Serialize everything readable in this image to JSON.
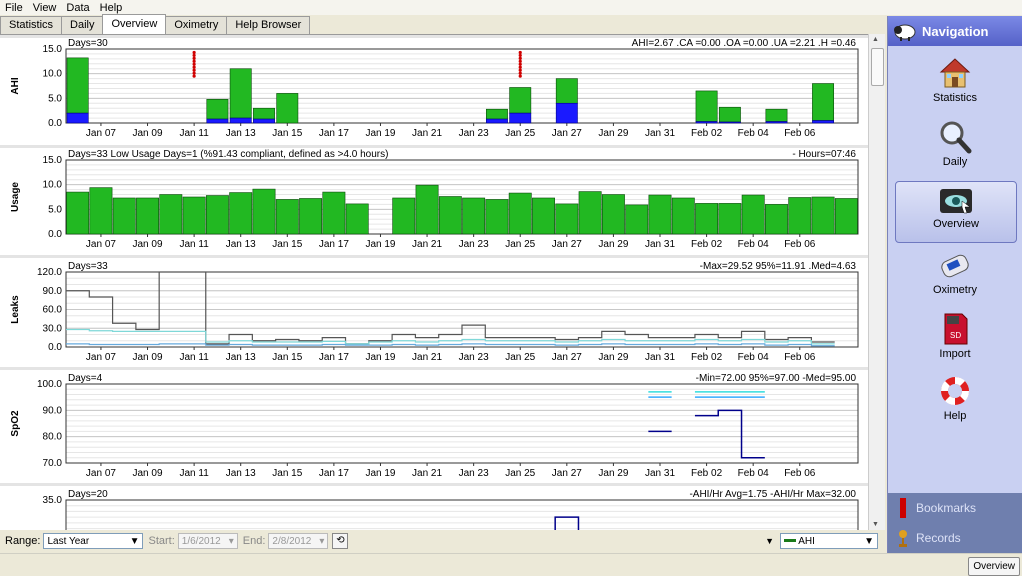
{
  "menu": [
    "File",
    "View",
    "Data",
    "Help"
  ],
  "tabs": [
    {
      "label": "Statistics",
      "active": false
    },
    {
      "label": "Daily",
      "active": false
    },
    {
      "label": "Overview",
      "active": true
    },
    {
      "label": "Oximetry",
      "active": false
    },
    {
      "label": "Help Browser",
      "active": false
    }
  ],
  "x_tick_labels": [
    "Jan 07",
    "Jan 09",
    "Jan 11",
    "Jan 13",
    "Jan 15",
    "Jan 17",
    "Jan 19",
    "Jan 21",
    "Jan 23",
    "Jan 25",
    "Jan 27",
    "Jan 29",
    "Jan 31",
    "Feb 02",
    "Feb 04",
    "Feb 06"
  ],
  "charts": {
    "ahi": {
      "ylabel": "AHI",
      "header_left": "Days=30",
      "header_right": "AHI=2.67  .CA =0.00  .OA =0.00  .UA =2.21  .H =0.46",
      "ticks": [
        "15.0",
        "10.0",
        "5.0",
        "0.0"
      ]
    },
    "usage": {
      "ylabel": "Usage",
      "header_left": "Days=33 Low Usage Days=1 (%91.43 compliant, defined as >4.0 hours)",
      "header_right": "- Hours=07:46",
      "ticks": [
        "15.0",
        "10.0",
        "5.0",
        "0.0"
      ]
    },
    "leaks": {
      "ylabel": "Leaks",
      "header_left": "Days=33",
      "header_right": "-Max=29.52  95%=11.91  .Med=4.63",
      "ticks": [
        "120.0",
        "90.0",
        "60.0",
        "30.0",
        "0.0"
      ]
    },
    "spo2": {
      "ylabel": "SpO2",
      "header_left": "Days=4",
      "header_right": "-Min=72.00  95%=97.00  -Med=95.00",
      "ticks": [
        "100.0",
        "90.0",
        "80.0",
        "70.0"
      ]
    },
    "ahihr": {
      "ylabel": "",
      "header_left": "Days=20",
      "header_right": "-AHI/Hr Avg=1.75  -AHI/Hr Max=32.00",
      "ticks": [
        "35.0",
        "28.0"
      ]
    }
  },
  "chart_data": [
    {
      "type": "bar",
      "title": "AHI",
      "ylim": [
        0,
        15
      ],
      "x_start": "Jan 06",
      "categories": [
        "Jan 06",
        "Jan 07",
        "Jan 08",
        "Jan 09",
        "Jan 10",
        "Jan 11",
        "Jan 12",
        "Jan 13",
        "Jan 14",
        "Jan 15",
        "Jan 16",
        "Jan 17",
        "Jan 18",
        "Jan 19",
        "Jan 20",
        "Jan 21",
        "Jan 22",
        "Jan 23",
        "Jan 24",
        "Jan 25",
        "Jan 26",
        "Jan 27",
        "Jan 28",
        "Jan 29",
        "Jan 30",
        "Jan 31",
        "Feb 01",
        "Feb 02",
        "Feb 03",
        "Feb 04",
        "Feb 05",
        "Feb 06",
        "Feb 07"
      ],
      "series": [
        {
          "name": "UA",
          "values": [
            2.0,
            0,
            0,
            0,
            0,
            0,
            0.8,
            1.0,
            0.8,
            0,
            0,
            0,
            0,
            0,
            0,
            0,
            0,
            0,
            0.8,
            2.0,
            0,
            4.0,
            0,
            0,
            0,
            0,
            0,
            0.3,
            0.2,
            0,
            0.3,
            0,
            0.5
          ]
        },
        {
          "name": "H",
          "values": [
            11.2,
            0,
            0,
            0,
            0,
            0,
            4.0,
            10.0,
            2.2,
            6.0,
            0,
            0,
            0,
            0,
            0,
            0,
            0,
            0,
            2.0,
            5.2,
            0,
            5.0,
            0,
            0,
            0,
            0,
            0,
            6.2,
            3.0,
            0,
            2.5,
            0,
            7.5
          ]
        }
      ]
    },
    {
      "type": "bar",
      "title": "Usage",
      "ylim": [
        0,
        15
      ],
      "x_start": "Jan 06",
      "values": [
        8.5,
        9.4,
        7.3,
        7.3,
        8.0,
        7.5,
        7.8,
        8.4,
        9.1,
        7.0,
        7.2,
        8.5,
        6.1,
        0,
        7.3,
        9.9,
        7.6,
        7.3,
        7.0,
        8.3,
        7.3,
        6.1,
        8.6,
        8.0,
        5.9,
        7.9,
        7.3,
        6.2,
        6.2,
        7.9,
        6.0,
        7.4,
        7.5,
        7.2
      ]
    },
    {
      "type": "line",
      "title": "Leaks",
      "ylim": [
        0,
        120
      ],
      "x_start": "Jan 06",
      "series": [
        {
          "name": "Max",
          "values": [
            90,
            80,
            38,
            28,
            120,
            120,
            5,
            20,
            10,
            12,
            10,
            15,
            5,
            10,
            20,
            15,
            20,
            35,
            15,
            15,
            15,
            12,
            15,
            25,
            20,
            15,
            15,
            20,
            15,
            25,
            12,
            15,
            8
          ]
        },
        {
          "name": "95%",
          "values": [
            28,
            26,
            25,
            25,
            25,
            25,
            8,
            10,
            8,
            8,
            8,
            9,
            5,
            8,
            10,
            8,
            10,
            12,
            10,
            10,
            10,
            8,
            10,
            12,
            10,
            10,
            10,
            12,
            10,
            12,
            8,
            10,
            5
          ]
        },
        {
          "name": "Med",
          "values": [
            5,
            4,
            4,
            4,
            5,
            5,
            3,
            4,
            3,
            3,
            3,
            4,
            3,
            3,
            4,
            3,
            4,
            5,
            4,
            4,
            4,
            3,
            4,
            5,
            4,
            4,
            4,
            5,
            4,
            5,
            3,
            4,
            2
          ]
        }
      ]
    },
    {
      "type": "line",
      "title": "SpO2",
      "ylim": [
        70,
        100
      ],
      "x_start": "Jan 06",
      "series": [
        {
          "name": "Min",
          "points": [
            [
              "Jan 31",
              82
            ],
            [
              "Feb 02",
              88
            ],
            [
              "Feb 03",
              90
            ],
            [
              "Feb 04",
              72
            ]
          ]
        },
        {
          "name": "95%",
          "points": [
            [
              "Jan 31",
              97
            ],
            [
              "Feb 02",
              97
            ],
            [
              "Feb 03",
              97
            ],
            [
              "Feb 04",
              97
            ]
          ]
        },
        {
          "name": "Med",
          "points": [
            [
              "Jan 31",
              95
            ],
            [
              "Feb 02",
              95
            ],
            [
              "Feb 03",
              95
            ],
            [
              "Feb 04",
              95
            ]
          ]
        }
      ]
    },
    {
      "type": "line",
      "title": "AHI/Hr",
      "ylim": [
        21,
        35
      ],
      "x_start": "Jan 06",
      "series": [
        {
          "name": "AHI/Hr Max",
          "points": [
            [
              "Jan 25",
              26
            ],
            [
              "Jan 27",
              32
            ],
            [
              "Feb 06",
              25
            ]
          ]
        }
      ]
    }
  ],
  "bottom": {
    "range_label": "Range:",
    "range_value": "Last Year",
    "start_label": "Start:",
    "start_value": "1/6/2012",
    "end_label": "End:",
    "end_value": "2/8/2012",
    "graph_select": "AHI"
  },
  "nav": {
    "title": "Navigation",
    "items": [
      "Statistics",
      "Daily",
      "Overview",
      "Oximetry",
      "Import",
      "Help"
    ],
    "selected": "Overview",
    "links": [
      "Bookmarks",
      "Records"
    ]
  },
  "status": {
    "button": "Overview"
  },
  "colors": {
    "green": "#22b822",
    "blue": "#1a1aff",
    "red": "#d00000",
    "navy": "#00008b",
    "cyan": "#33cccc",
    "gray": "#666666"
  }
}
